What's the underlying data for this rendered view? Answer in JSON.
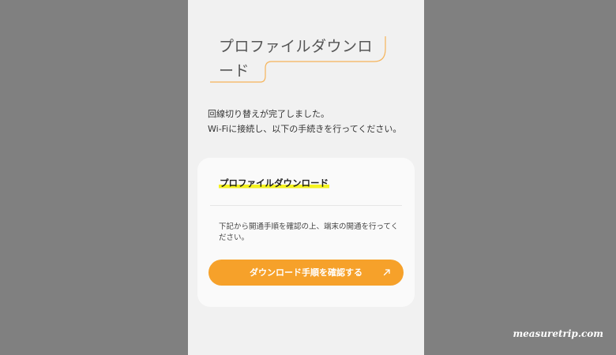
{
  "header": {
    "title_line1": "プロファイルダウンロ",
    "title_line2": "ード"
  },
  "intro": {
    "line1": "回線切り替えが完了しました。",
    "line2": "Wi-Fiに接続し、以下の手続きを行ってください。"
  },
  "card": {
    "title": "プロファイルダウンロード",
    "description": "下記から開通手順を確認の上、端末の開通を行ってください。",
    "button_label": "ダウンロード手順を確認する",
    "button_icon": "external-arrow-icon"
  },
  "watermark": "measuretrip.com",
  "colors": {
    "page_background": "#808080",
    "screen_background": "#f1f1f1",
    "accent": "#f6a12a",
    "highlight": "#f4f31f"
  }
}
